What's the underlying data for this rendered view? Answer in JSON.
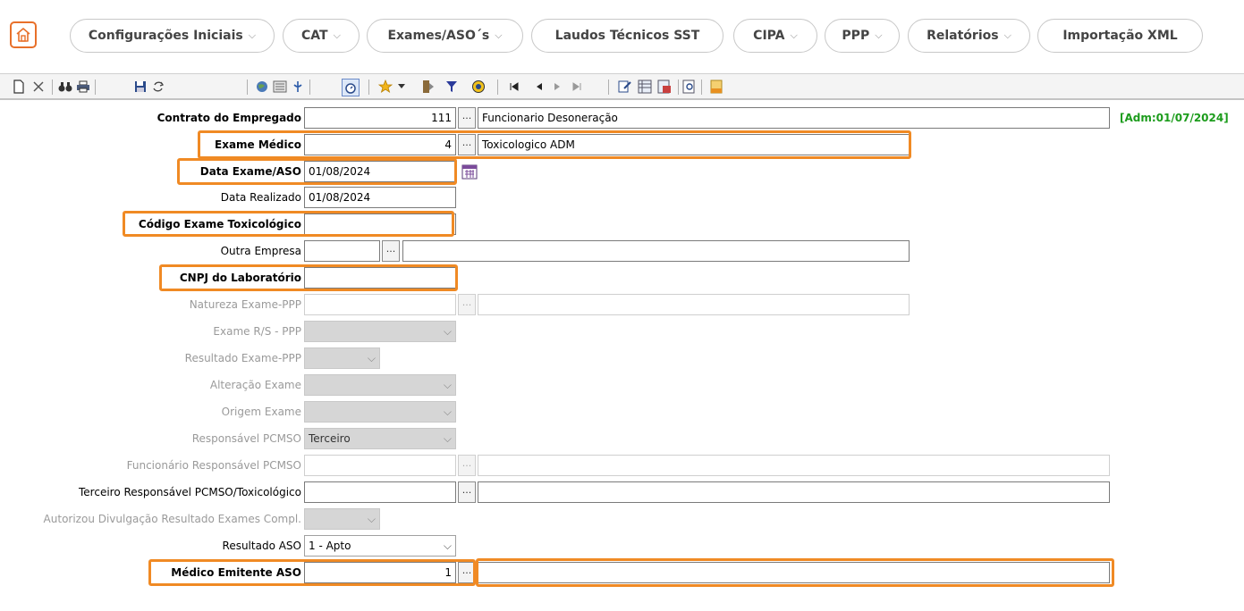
{
  "nav": {
    "items": [
      {
        "label": "Configurações Iniciais"
      },
      {
        "label": "CAT"
      },
      {
        "label": "Exames/ASO´s"
      },
      {
        "label": "Laudos Técnicos SST"
      },
      {
        "label": "CIPA"
      },
      {
        "label": "PPP"
      },
      {
        "label": "Relatórios"
      },
      {
        "label": "Importação XML"
      }
    ],
    "chevron": "⌵"
  },
  "toolbar": {
    "icons": [
      "new-document",
      "delete",
      "find",
      "print",
      "save",
      "refresh",
      "globe",
      "list",
      "info",
      "stopwatch",
      "star",
      "dropdown",
      "exit-door",
      "filter",
      "clock",
      "first-record",
      "previous-record",
      "next-record",
      "last-record",
      "edit",
      "grid",
      "export",
      "preview",
      "xml"
    ]
  },
  "form": {
    "admission_tag": "[Adm:01/07/2024]",
    "contrato": {
      "label": "Contrato do Empregado",
      "code": "111",
      "desc": "Funcionario Desoneração"
    },
    "exame_medico": {
      "label": "Exame Médico",
      "code": "4",
      "desc": "Toxicologico ADM"
    },
    "data_exame": {
      "label": "Data Exame/ASO",
      "value": "01/08/2024"
    },
    "data_realizado": {
      "label": "Data Realizado",
      "value": "01/08/2024"
    },
    "codigo_tox": {
      "label": "Código Exame Toxicológico",
      "value": ""
    },
    "outra_empresa": {
      "label": "Outra Empresa",
      "code": "",
      "desc": ""
    },
    "cnpj_lab": {
      "label": "CNPJ do Laboratório",
      "value": ""
    },
    "natureza": {
      "label": "Natureza Exame-PPP",
      "code": "",
      "desc": ""
    },
    "exame_rs": {
      "label": "Exame R/S - PPP",
      "value": ""
    },
    "resultado_ppp": {
      "label": "Resultado Exame-PPP",
      "value": ""
    },
    "alteracao": {
      "label": "Alteração Exame",
      "value": ""
    },
    "origem": {
      "label": "Origem Exame",
      "value": ""
    },
    "responsavel": {
      "label": "Responsável PCMSO",
      "value": "Terceiro"
    },
    "func_resp": {
      "label": "Funcionário Responsável PCMSO",
      "code": "",
      "desc": ""
    },
    "terceiro_resp": {
      "label": "Terceiro Responsável PCMSO/Toxicológico",
      "code": "",
      "desc": ""
    },
    "autorizou": {
      "label": "Autorizou Divulgação Resultado Exames Compl.",
      "value": ""
    },
    "resultado_aso": {
      "label": "Resultado ASO",
      "value": "1 - Apto"
    },
    "medico": {
      "label": "Médico Emitente ASO",
      "code": "1",
      "desc": ""
    },
    "ellipsis": "..."
  },
  "colors": {
    "highlight": "#f08a24",
    "home": "#e8702a",
    "admission": "#1c9c1c"
  }
}
